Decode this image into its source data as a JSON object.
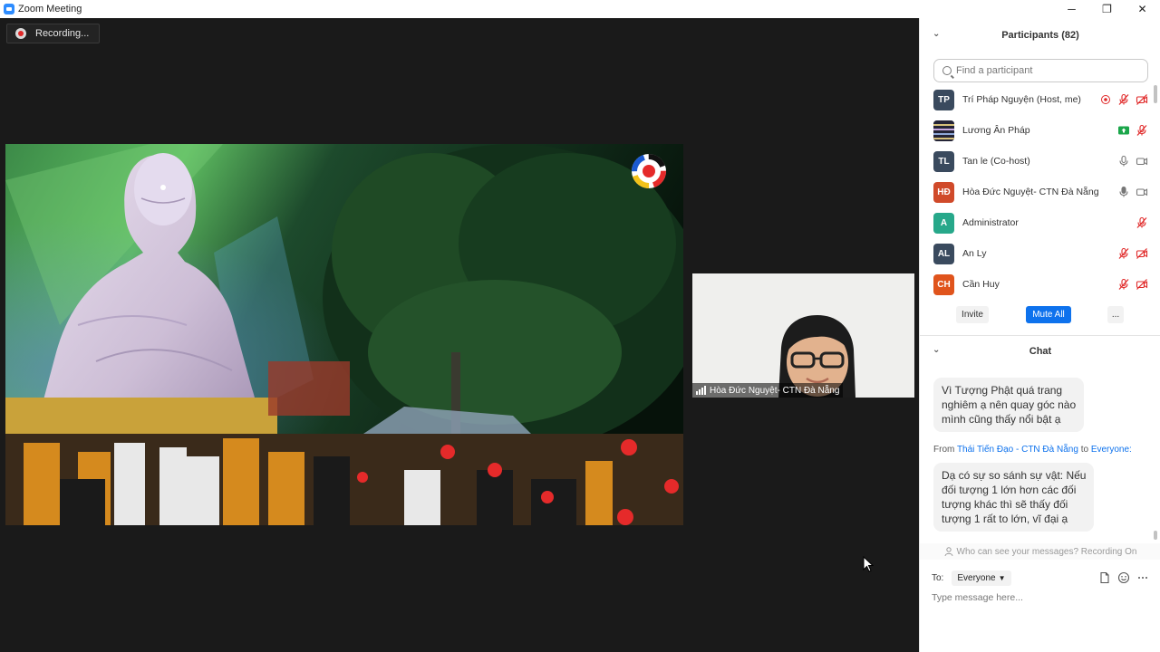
{
  "window": {
    "title": "Zoom Meeting",
    "minimize": "─",
    "maximize": "❐",
    "close": "✕"
  },
  "recording": {
    "label": "Recording..."
  },
  "thumbnail": {
    "name": "Hòa Đức Nguyệt- CTN Đà Nẵng"
  },
  "participants": {
    "title": "Participants (82)",
    "search_placeholder": "Find a participant",
    "list": [
      {
        "initials": "TP",
        "name": "Trí Pháp Nguyện (Host, me)",
        "color": "#3a4a5e",
        "audio": "muted",
        "video": "off",
        "recording": true
      },
      {
        "initials": "",
        "name": "Lương Ân Pháp",
        "color": "#2a2a38",
        "audio": "muted",
        "share": true,
        "photo": true
      },
      {
        "initials": "TL",
        "name": "Tan le (Co-host)",
        "color": "#3a4a5e",
        "audio": "on",
        "video": "on"
      },
      {
        "initials": "HĐ",
        "name": "Hòa Đức Nguyệt- CTN Đà Nẵng",
        "color": "#d04a2a",
        "audio": "active",
        "video": "on"
      },
      {
        "initials": "A",
        "name": "Administrator",
        "color": "#27a88a",
        "audio": "muted"
      },
      {
        "initials": "AL",
        "name": "An Ly",
        "color": "#3a4a5e",
        "audio": "muted",
        "video": "off"
      },
      {
        "initials": "CH",
        "name": "Cần Huy",
        "color": "#e0541c",
        "audio": "muted",
        "video": "off"
      }
    ],
    "invite": "Invite",
    "mute_all": "Mute All",
    "more": "..."
  },
  "chat": {
    "title": "Chat",
    "message1": [
      "Vì Tượng Phật quá trang",
      "nghiêm ạ nên quay góc nào",
      "mình cũng thấy nổi bật ạ"
    ],
    "from_prefix": "From",
    "from_sender": "Thái Tiến Đạo - CTN Đà Nẵng",
    "from_to": "to",
    "from_recipient": "Everyone:",
    "message2": [
      "Dạ có sự so sánh sự vật: Nếu",
      "đối tượng 1 lớn hơn các đối",
      "tượng khác thì sẽ thấy đối",
      "tượng 1 rất to lớn, vĩ đại ạ"
    ],
    "who_can_see": "Who can see your messages? Recording On",
    "to_label": "To:",
    "to_value": "Everyone",
    "input_placeholder": "Type message here..."
  },
  "colors": {
    "accent": "#0e72ed",
    "stage_bg": "#1a1a1a",
    "muted_red": "#e02828",
    "share_green": "#1aa64a"
  }
}
